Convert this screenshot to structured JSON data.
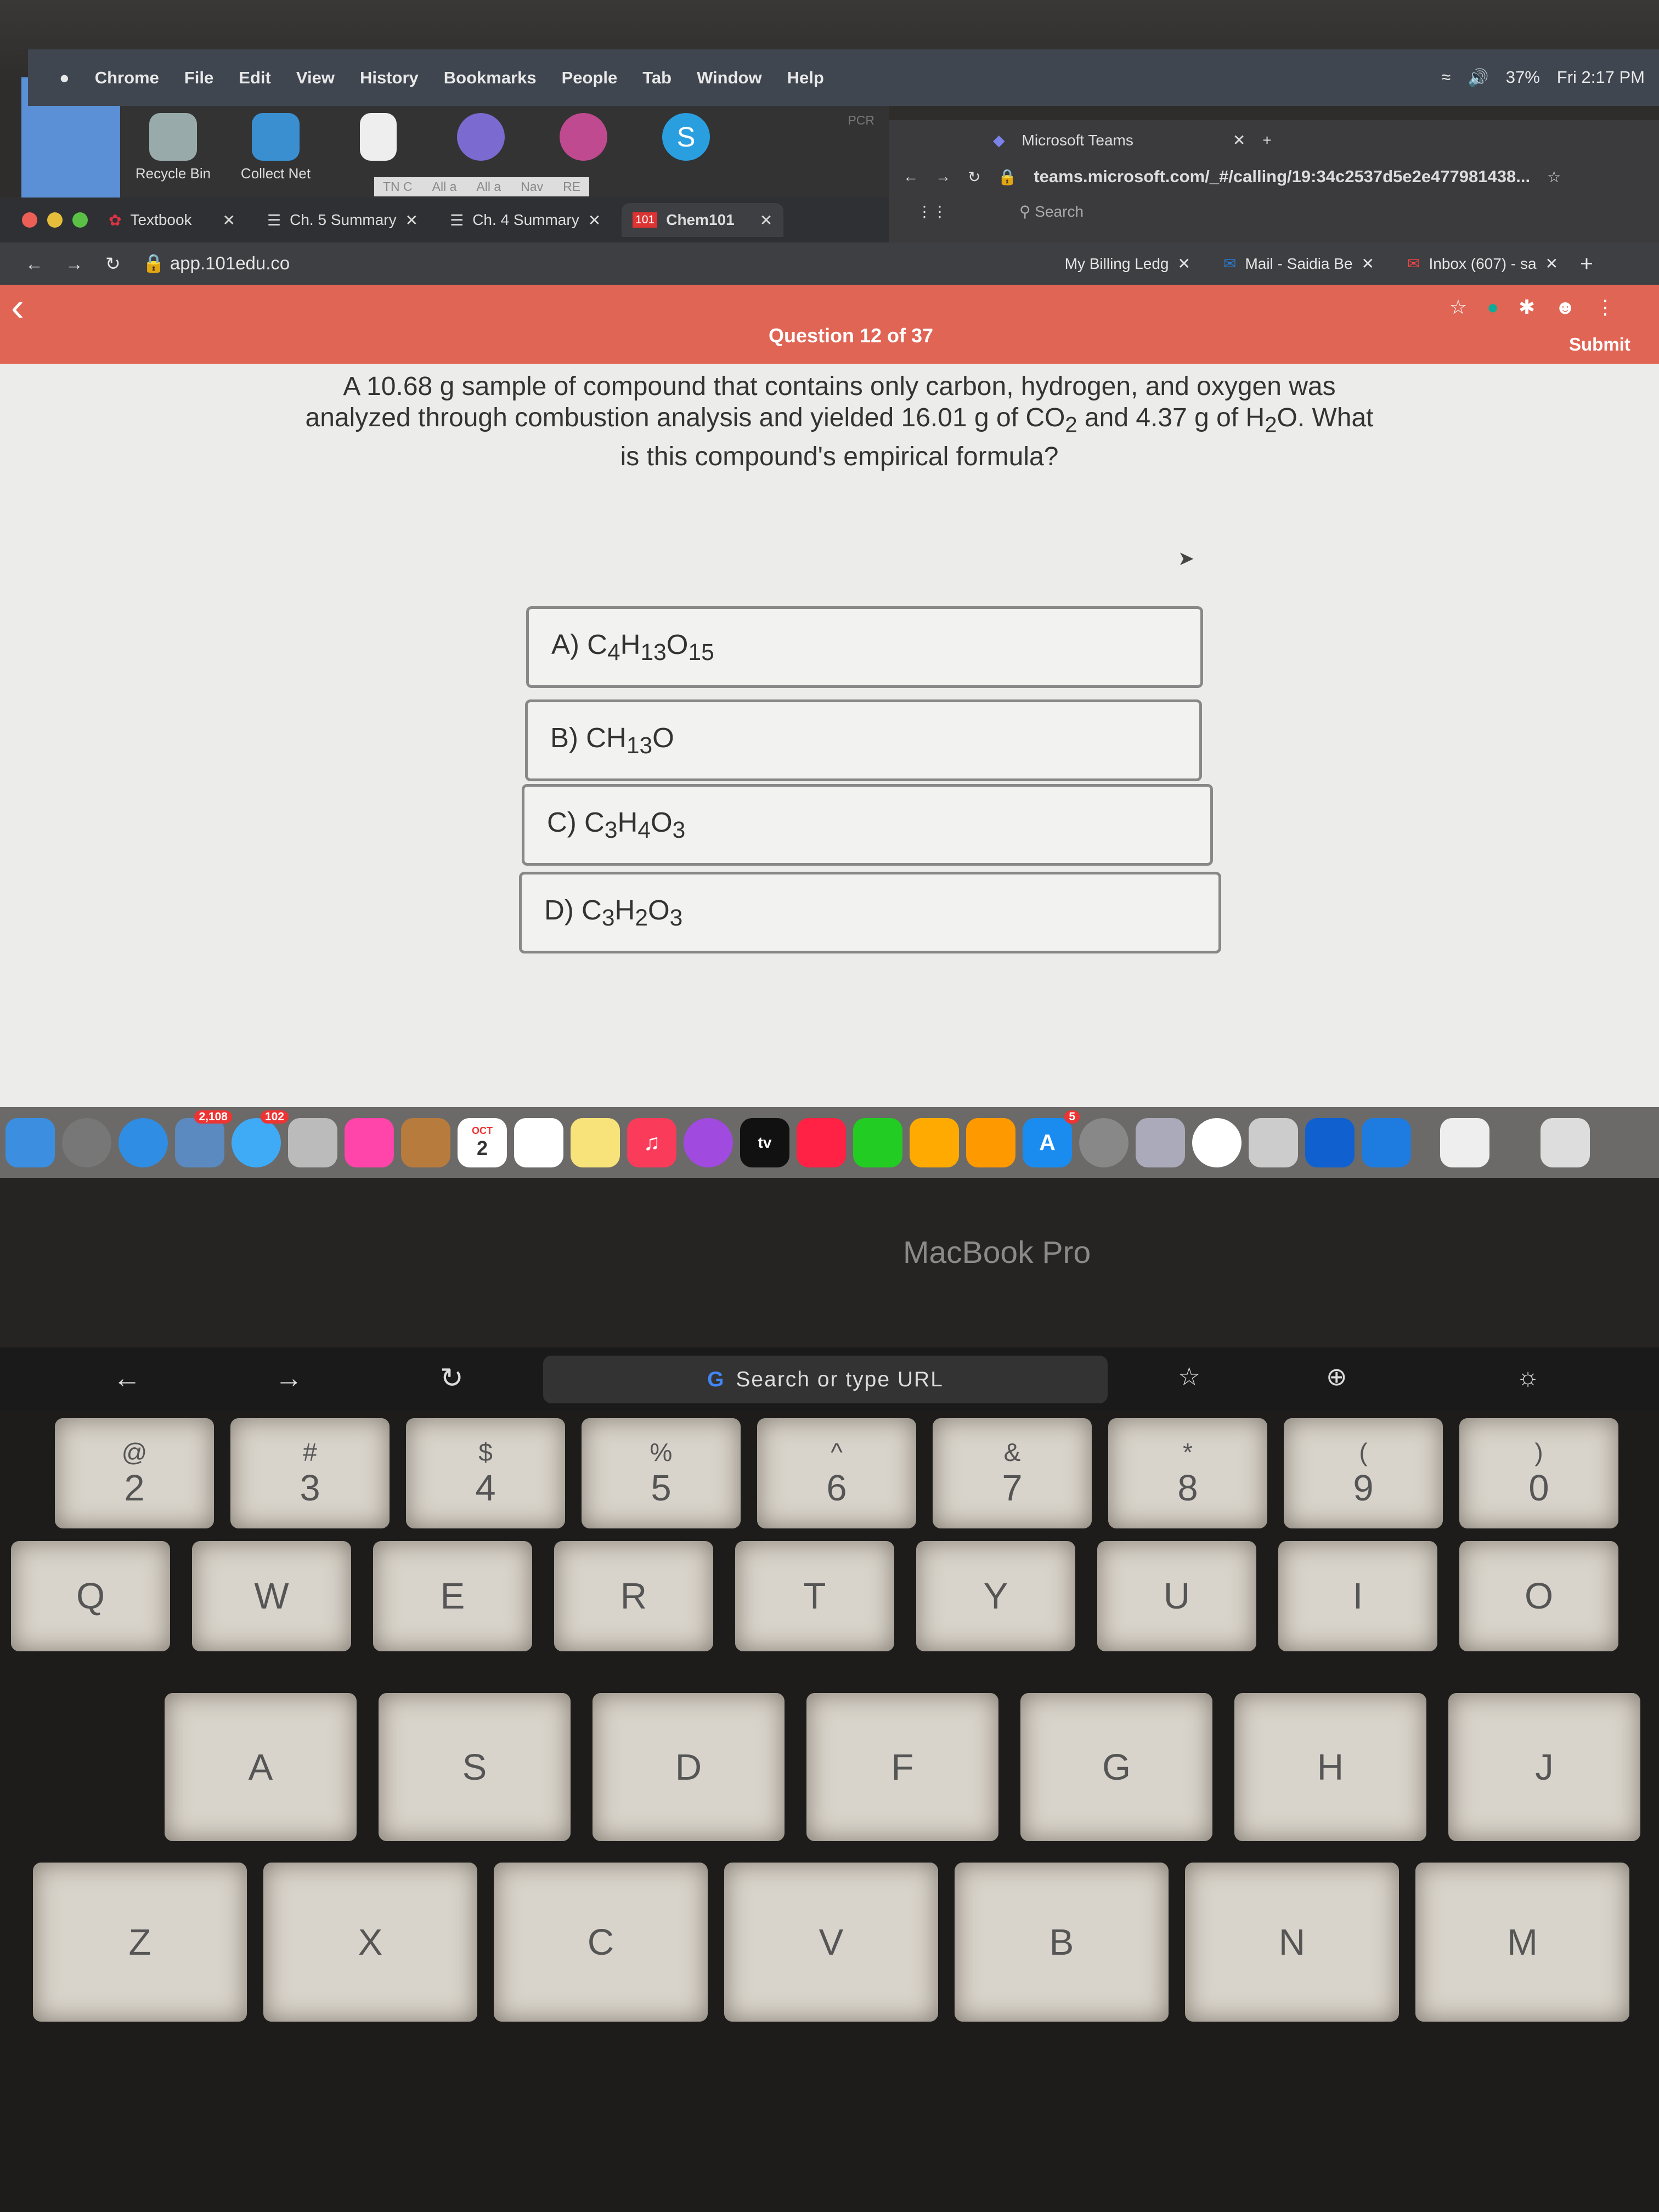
{
  "menubar": {
    "app": "Chrome",
    "items": [
      "File",
      "Edit",
      "View",
      "History",
      "Bookmarks",
      "People",
      "Tab",
      "Window",
      "Help"
    ],
    "battery": "37%",
    "clock": "Fri 2:17 PM"
  },
  "desktop": {
    "icons": [
      {
        "label": "Recycle Bin"
      },
      {
        "label": "Collect Net"
      },
      {
        "label": ""
      },
      {
        "label": ""
      },
      {
        "label": ""
      },
      {
        "label": ""
      }
    ],
    "mini_tabs": [
      "TN C",
      "All a",
      "All a",
      "Nav",
      "RE"
    ],
    "hint": "PCR"
  },
  "teams": {
    "tab": "Microsoft Teams",
    "url": "teams.microsoft.com/_#/calling/19:34c2537d5e2e477981438...",
    "search": "Search"
  },
  "chrome": {
    "tabs": [
      {
        "label": "Textbook"
      },
      {
        "label": "Ch. 5 Summary"
      },
      {
        "label": "Ch. 4 Summary"
      },
      {
        "label": "Chem101",
        "active": true
      },
      {
        "label": "My Billing Ledg"
      },
      {
        "label": "Mail - Saidia Be"
      },
      {
        "label": "Inbox (607) - sa"
      }
    ],
    "url": "app.101edu.co",
    "chem_badge": "101"
  },
  "quiz": {
    "progress": "Question 12 of 37",
    "submit": "Submit",
    "question_html": "A 10.68 g sample of compound that contains only carbon, hydrogen, and oxygen was analyzed through combustion analysis and yielded 16.01 g of CO<sub>2</sub> and 4.37 g of H<sub>2</sub>O. What is this compound's empirical formula?",
    "options": [
      {
        "html": "A) C<sub>4</sub>H<sub>13</sub>O<sub>15</sub>"
      },
      {
        "html": "B) CH<sub>13</sub>O"
      },
      {
        "html": "C) C<sub>3</sub>H<sub>4</sub>O<sub>3</sub>"
      },
      {
        "html": "D) C<sub>3</sub>H<sub>2</sub>O<sub>3</sub>"
      }
    ]
  },
  "dock": {
    "mail_badge": "2,108",
    "messages_badge": "102",
    "calendar_month": "OCT",
    "calendar_day": "2",
    "tv": "tv",
    "appstore_badge": "5"
  },
  "laptop": {
    "brand": "MacBook Pro"
  },
  "touchbar": {
    "search": "Search or type URL"
  },
  "keys": {
    "row1": [
      [
        "@",
        "2"
      ],
      [
        "#",
        "3"
      ],
      [
        "$",
        "4"
      ],
      [
        "%",
        "5"
      ],
      [
        "^",
        "6"
      ],
      [
        "&",
        "7"
      ],
      [
        "*",
        "8"
      ],
      [
        "(",
        "9"
      ],
      [
        ")",
        "0"
      ]
    ],
    "row2": [
      "Q",
      "W",
      "E",
      "R",
      "T",
      "Y",
      "U",
      "I",
      "O"
    ],
    "row3": [
      "A",
      "S",
      "D",
      "F",
      "G",
      "H",
      "J"
    ],
    "row4": [
      "Z",
      "X",
      "C",
      "V",
      "B",
      "N",
      "M"
    ]
  },
  "colors": {
    "header": "#e06555",
    "menubar": "#3f4650"
  }
}
